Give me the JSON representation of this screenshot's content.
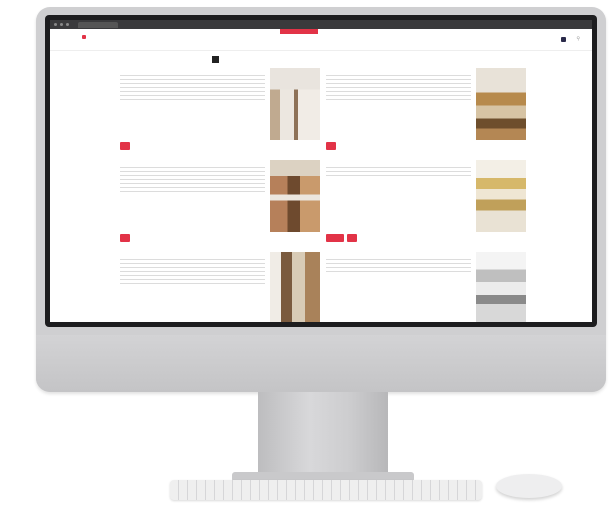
{
  "browser": {
    "tab_label": ""
  },
  "site": {
    "logo_text": "",
    "logo_accent": "",
    "promo_badge": "",
    "nav": [
      {
        "label": ""
      },
      {
        "label": ""
      },
      {
        "label": ""
      },
      {
        "label": ""
      },
      {
        "label": ""
      },
      {
        "label": ""
      }
    ],
    "header_links": [
      {
        "label": ""
      },
      {
        "label": ""
      },
      {
        "label": ""
      }
    ],
    "search_icon": "search-icon",
    "user_icon": "user-icon"
  },
  "subbar": {
    "breadcrumb": "",
    "filter_label": ""
  },
  "articles": [
    {
      "title": "",
      "tags": [
        {
          "label": ""
        }
      ]
    },
    {
      "title": "",
      "tags": [
        {
          "label": ""
        }
      ]
    },
    {
      "title": "",
      "tags": [
        {
          "label": ""
        }
      ]
    },
    {
      "title": "",
      "tags": [
        {
          "label": ""
        },
        {
          "label": ""
        }
      ]
    },
    {
      "title": "",
      "tags": []
    },
    {
      "title": "",
      "tags": []
    }
  ],
  "colors": {
    "accent": "#e23347",
    "text": "#333333",
    "muted": "#999999",
    "monitor_body": "#cfcfd1",
    "bezel": "#1d1d1f"
  }
}
